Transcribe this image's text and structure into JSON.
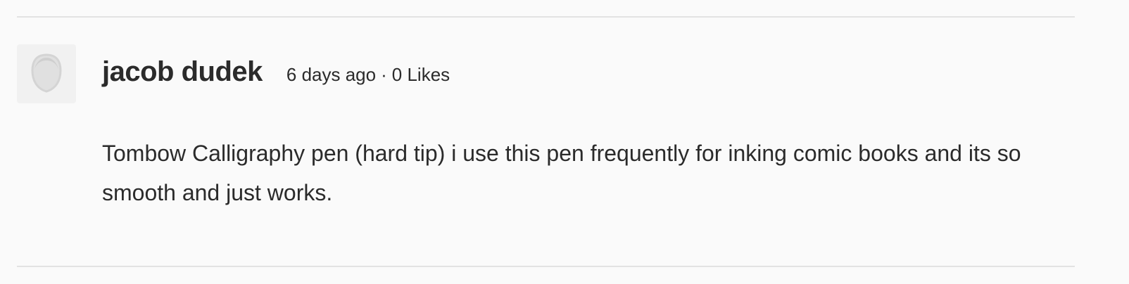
{
  "comment": {
    "author": "jacob dudek",
    "time_ago": "6 days ago",
    "separator": "·",
    "likes": "0 Likes",
    "body": "Tombow Calligraphy pen (hard tip) i use this pen frequently for inking comic books and its so smooth and just works.",
    "avatar_icon": "default-user-silhouette-icon"
  },
  "colors": {
    "background": "#fafafa",
    "divider": "#e2e2e2",
    "text": "#2b2b2b",
    "avatar_bg": "#f1f1f1",
    "avatar_icon": "#d9d9d9"
  }
}
